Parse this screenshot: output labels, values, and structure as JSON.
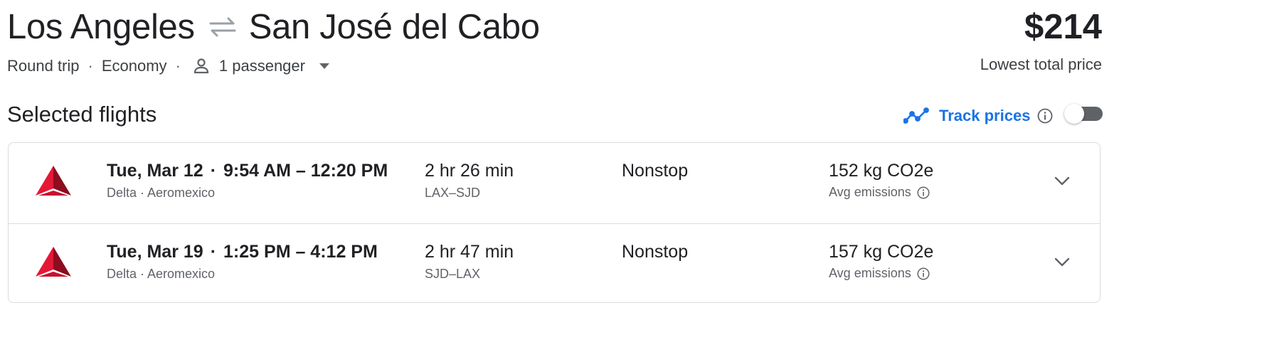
{
  "header": {
    "origin": "Los Angeles",
    "destination": "San José del Cabo",
    "price": "$214",
    "price_label": "Lowest total price"
  },
  "trip": {
    "type": "Round trip",
    "cabin": "Economy",
    "passengers": "1 passenger"
  },
  "section": {
    "title": "Selected flights",
    "track_prices_label": "Track prices",
    "track_prices_enabled": false
  },
  "flights": [
    {
      "date": "Tue, Mar 12",
      "times": "9:54 AM – 12:20 PM",
      "airlines": "Delta · Aeromexico",
      "duration": "2 hr 26 min",
      "route": "LAX–SJD",
      "stops": "Nonstop",
      "emissions": "152 kg CO2e",
      "emissions_label": "Avg emissions"
    },
    {
      "date": "Tue, Mar 19",
      "times": "1:25 PM – 4:12 PM",
      "airlines": "Delta · Aeromexico",
      "duration": "2 hr 47 min",
      "route": "SJD–LAX",
      "stops": "Nonstop",
      "emissions": "157 kg CO2e",
      "emissions_label": "Avg emissions"
    }
  ],
  "icons": {
    "swap": "swap-arrows-icon",
    "passenger": "person-icon",
    "dropdown": "caret-down-icon",
    "trend": "trending-line-icon",
    "info": "info-icon",
    "airline_logo": "delta-logo",
    "expand": "chevron-down-icon"
  },
  "colors": {
    "accent": "#1a73e8",
    "text": "#202124",
    "secondary_text": "#5f6368",
    "border": "#dadce0",
    "delta_red": "#c8102e"
  }
}
